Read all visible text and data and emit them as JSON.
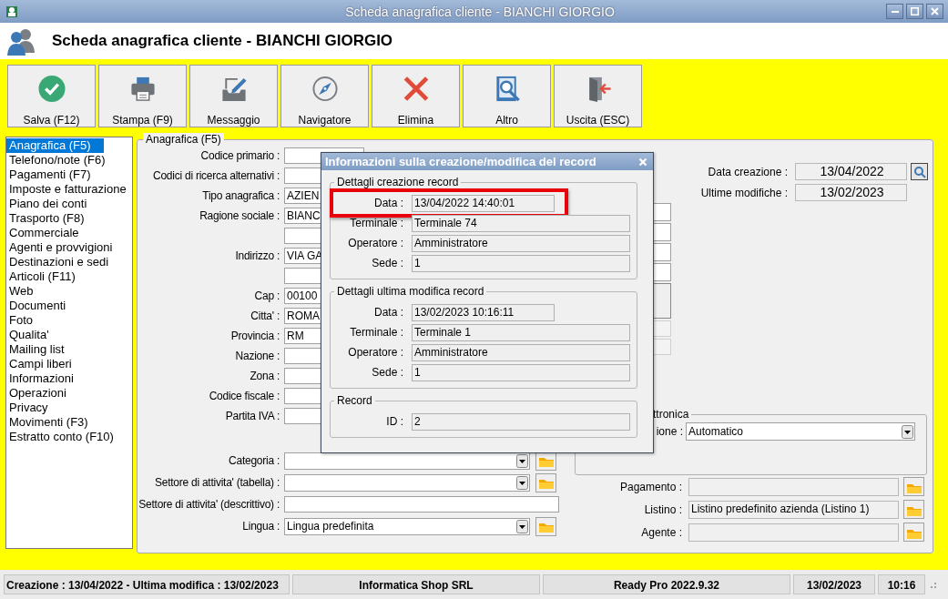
{
  "window": {
    "title": "Scheda anagrafica cliente - BIANCHI GIORGIO"
  },
  "header": {
    "title": "Scheda anagrafica cliente - BIANCHI GIORGIO"
  },
  "toolbar": [
    {
      "label": "Salva (F12)",
      "kind": "save"
    },
    {
      "label": "Stampa (F9)",
      "kind": "print"
    },
    {
      "label": "Messaggio",
      "kind": "message"
    },
    {
      "label": "Navigatore",
      "kind": "navigator"
    },
    {
      "label": "Elimina",
      "kind": "delete"
    },
    {
      "label": "Altro",
      "kind": "other"
    },
    {
      "label": "Uscita (ESC)",
      "kind": "exit"
    }
  ],
  "sidebar": {
    "items": [
      {
        "label": "Anagrafica (F5)",
        "selected": true
      },
      {
        "label": "Telefono/note (F6)",
        "selected": false
      },
      {
        "label": "Pagamenti (F7)",
        "selected": false
      },
      {
        "label": "Imposte e fatturazione",
        "selected": false
      },
      {
        "label": "Piano dei conti",
        "selected": false
      },
      {
        "label": "Trasporto (F8)",
        "selected": false
      },
      {
        "label": "Commerciale",
        "selected": false
      },
      {
        "label": "Agenti e provvigioni",
        "selected": false
      },
      {
        "label": "Destinazioni e sedi",
        "selected": false
      },
      {
        "label": "Articoli (F11)",
        "selected": false
      },
      {
        "label": "Web",
        "selected": false
      },
      {
        "label": "Documenti",
        "selected": false
      },
      {
        "label": "Foto",
        "selected": false
      },
      {
        "label": "Qualita'",
        "selected": false
      },
      {
        "label": "Mailing list",
        "selected": false
      },
      {
        "label": "Campi liberi",
        "selected": false
      },
      {
        "label": "Informazioni",
        "selected": false
      },
      {
        "label": "Operazioni",
        "selected": false
      },
      {
        "label": "Privacy",
        "selected": false
      },
      {
        "label": "Movimenti (F3)",
        "selected": false
      },
      {
        "label": "Estratto conto (F10)",
        "selected": false
      }
    ]
  },
  "form": {
    "legend": "Anagrafica (F5)",
    "fields": [
      {
        "label": "Codice primario :",
        "kind": "short"
      },
      {
        "label": "Codici di ricerca alternativi :",
        "kind": "text"
      },
      {
        "label": "Tipo anagrafica :",
        "value": "AZIEN",
        "kind": "text"
      },
      {
        "label": "Ragione sociale :",
        "value": "BIANC",
        "kind": "text"
      },
      {
        "kind": "text"
      },
      {
        "label": "Indirizzo :",
        "value": "VIA GA",
        "kind": "text"
      },
      {
        "kind": "text"
      },
      {
        "label": "Cap :",
        "value": "00100",
        "kind": "text"
      },
      {
        "label": "Citta' :",
        "value": "ROMA",
        "kind": "text"
      },
      {
        "label": "Provincia :",
        "value": "RM",
        "kind": "text"
      },
      {
        "label": "Nazione :",
        "kind": "text"
      },
      {
        "label": "Zona :",
        "kind": "text"
      },
      {
        "label": "Codice fiscale :",
        "kind": "text"
      },
      {
        "label": "Partita IVA :",
        "kind": "text"
      }
    ],
    "classification": [
      {
        "label": "Categoria :",
        "kind": "combo"
      },
      {
        "label": "Settore di attivita' (tabella) :",
        "kind": "combo"
      },
      {
        "label": "Settore di attivita' (descrittivo) :",
        "kind": "wide"
      },
      {
        "label": "Lingua :",
        "value": "Lingua predefinita",
        "kind": "combo"
      }
    ],
    "dates": [
      {
        "label": "Data creazione :",
        "value": "13/04/2022",
        "lookup": true
      },
      {
        "label": "Ultime modifiche :",
        "value": "13/02/2023",
        "lookup": false
      }
    ],
    "e_invoice": {
      "legend": "ttronica",
      "label": "ione :",
      "value": "Automatico"
    },
    "accounts": [
      {
        "label": "Pagamento :"
      },
      {
        "label": "Listino :",
        "value": "Listino predefinito azienda (Listino 1)"
      },
      {
        "label": "Agente :"
      }
    ]
  },
  "dialog": {
    "title": "Informazioni sulla creazione/modifica del record",
    "sections": [
      {
        "legend": "Dettagli creazione record",
        "fields": [
          {
            "label": "Data :",
            "value": "13/04/2022 14:40:01",
            "kind": "date",
            "highlighted": true
          },
          {
            "label": "Terminale :",
            "value": "Terminale 74",
            "kind": "text",
            "highlighted": false
          },
          {
            "label": "Operatore :",
            "value": "Amministratore",
            "kind": "text",
            "highlighted": false
          },
          {
            "label": "Sede :",
            "value": "1",
            "kind": "text",
            "highlighted": false
          }
        ]
      },
      {
        "legend": "Dettagli ultima modifica record",
        "fields": [
          {
            "label": "Data :",
            "value": "13/02/2023 10:16:11",
            "kind": "date",
            "highlighted": false
          },
          {
            "label": "Terminale :",
            "value": "Terminale 1",
            "kind": "text",
            "highlighted": false
          },
          {
            "label": "Operatore :",
            "value": "Amministratore",
            "kind": "text",
            "highlighted": false
          },
          {
            "label": "Sede :",
            "value": "1",
            "kind": "text",
            "highlighted": false
          }
        ]
      },
      {
        "legend": "Record",
        "fields": [
          {
            "label": "ID :",
            "value": "2",
            "kind": "text",
            "highlighted": false
          }
        ]
      }
    ]
  },
  "status_bar": [
    "Creazione : 13/04/2022 - Ultima modifica : 13/02/2023",
    "Informatica Shop SRL",
    "Ready Pro 2022.9.32",
    "13/02/2023",
    "10:16"
  ]
}
